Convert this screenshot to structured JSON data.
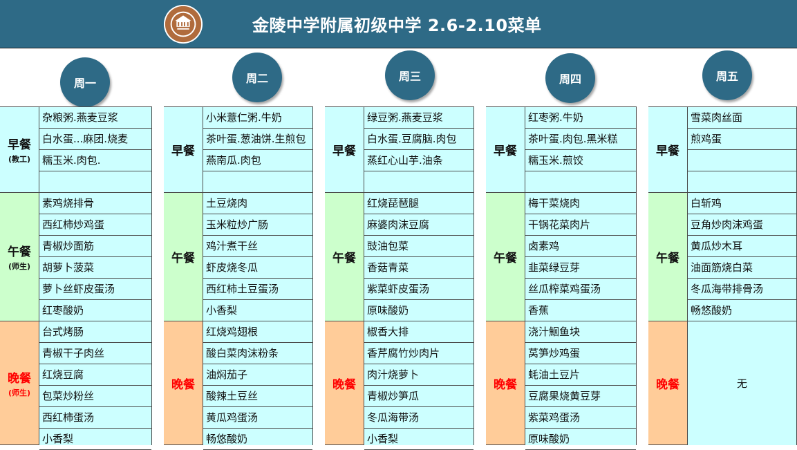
{
  "header": {
    "title": "金陵中学附属初级中学 2.6-2.10菜单",
    "background": "#2e6a86",
    "logo_icon": "school-seal-icon"
  },
  "colors": {
    "breakfast": "#ccffff",
    "lunch": "#ccffcc",
    "dinner": "#ffcc99",
    "items": "#ccffff",
    "red_label": "#ff0000"
  },
  "meal_labels": {
    "breakfast": "早餐",
    "lunch": "午餐",
    "dinner": "晚餐",
    "teachers": "(教工)",
    "teachers_students": "(师生)"
  },
  "days": [
    {
      "name": "周一",
      "breakfast": [
        "杂粮粥.燕麦豆浆",
        "白水蛋...麻团.烧麦",
        "糯玉米.肉包.",
        ""
      ],
      "lunch": [
        "素鸡烧排骨",
        "西红柿炒鸡蛋",
        "青椒炒面筋",
        "胡萝卜菠菜",
        "萝卜丝虾皮蛋汤",
        "红枣酸奶"
      ],
      "dinner": [
        "台式烤肠",
        "青椒干子肉丝",
        "红烧豆腐",
        "包菜炒粉丝",
        "西红柿蛋汤",
        "小香梨"
      ]
    },
    {
      "name": "周二",
      "breakfast": [
        "小米薏仁粥.牛奶",
        "茶叶蛋.葱油饼.生煎包",
        "燕南瓜.肉包",
        ""
      ],
      "lunch": [
        "土豆烧肉",
        "玉米粒炒广肠",
        "鸡汁煮干丝",
        "虾皮烧冬瓜",
        "西红柿土豆蛋汤",
        "小香梨"
      ],
      "dinner": [
        "红烧鸡翅根",
        "酸白菜肉沫粉条",
        "油焖茄子",
        "酸辣土豆丝",
        "黄瓜鸡蛋汤",
        "畅悠酸奶"
      ]
    },
    {
      "name": "周三",
      "breakfast": [
        "绿豆粥.燕麦豆浆",
        "白水蛋.豆腐脑.肉包",
        "蒸红心山芋.油条",
        ""
      ],
      "lunch": [
        "红烧琵琶腿",
        "麻婆肉沫豆腐",
        "豉油包菜",
        "香菇青菜",
        "紫菜虾皮蛋汤",
        "原味酸奶"
      ],
      "dinner": [
        "椒香大排",
        "香芹腐竹炒肉片",
        "肉汁烧萝卜",
        "青椒炒笋瓜",
        "冬瓜海带汤",
        "小香梨"
      ]
    },
    {
      "name": "周四",
      "breakfast": [
        "红枣粥.牛奶",
        "茶叶蛋.肉包.黑米糕",
        "糯玉米.煎饺",
        ""
      ],
      "lunch": [
        "梅干菜烧肉",
        "干锅花菜肉片",
        "卤素鸡",
        "韭菜绿豆芽",
        "丝瓜榨菜鸡蛋汤",
        "香蕉"
      ],
      "dinner": [
        "浇汁鮰鱼块",
        "莴笋炒鸡蛋",
        "蚝油土豆片",
        "豆腐果烧黄豆芽",
        "紫菜鸡蛋汤",
        "原味酸奶"
      ]
    },
    {
      "name": "周五",
      "breakfast": [
        "雪菜肉丝面",
        "煎鸡蛋",
        "",
        ""
      ],
      "lunch": [
        "白斩鸡",
        "豆角炒肉沫鸡蛋",
        "黄瓜炒木耳",
        "油面筋烧白菜",
        "冬瓜海带排骨汤",
        "畅悠酸奶"
      ],
      "dinner_none": "无"
    }
  ]
}
